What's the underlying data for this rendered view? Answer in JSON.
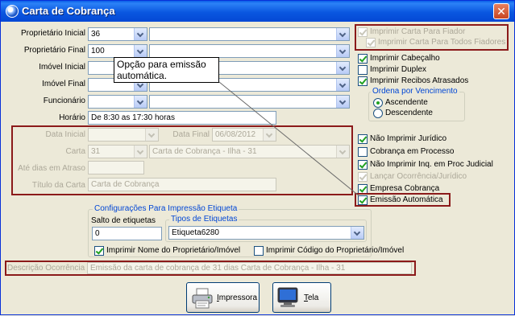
{
  "window": {
    "title": "Carta de Cobrança",
    "close_glyph": "✕"
  },
  "tooltip": {
    "text": "Opção para emissão automática."
  },
  "fields": {
    "proprietario_inicial": {
      "label": "Proprietário Inicial",
      "code": "36",
      "name": ""
    },
    "proprietario_final": {
      "label": "Proprietário Final",
      "code": "100",
      "name": ""
    },
    "imovel_inicial": {
      "label": "Imóvel Inicial",
      "code": "",
      "name": ""
    },
    "imovel_final": {
      "label": "Imóvel Final",
      "code": "",
      "name": ""
    },
    "funcionario": {
      "label": "Funcionário",
      "code": "",
      "name": ""
    },
    "horario": {
      "label": "Horário",
      "value": "De 8:30 as 17:30 horas"
    },
    "data_inicial": {
      "label": "Data Inicial",
      "value": ""
    },
    "data_final": {
      "label": "Data Final",
      "value": "06/08/2012"
    },
    "carta": {
      "label": "Carta",
      "code": "31",
      "name": "Carta de Cobrança - Ilha - 31"
    },
    "ate_dias_atraso": {
      "label": "Até dias em Atraso",
      "value": ""
    },
    "titulo_carta": {
      "label": "Título da Carta",
      "value": "Carta de Cobrança"
    },
    "descricao_ocorrencia": {
      "label": "Descrição Ocorrência",
      "value": "Emissão da carta de cobrança de 31 dias Carta de Cobrança - Ilha - 31"
    }
  },
  "options": {
    "imprimir_carta_fiador": {
      "label": "Imprimir Carta Para Fiador",
      "checked": true,
      "enabled": false
    },
    "imprimir_carta_todos_fiadores": {
      "label": "Imprimir Carta Para Todos Fiadores",
      "checked": true,
      "enabled": false
    },
    "imprimir_cabecalho": {
      "label": "Imprimir Cabeçalho",
      "checked": true
    },
    "imprimir_duplex": {
      "label": "Imprimir Duplex",
      "checked": false
    },
    "imprimir_recibos_atrasados": {
      "label": "Imprimir Recibos Atrasados",
      "checked": true
    },
    "nao_imprimir_juridico": {
      "label": "Não Imprimir Jurídico",
      "checked": true
    },
    "cobranca_em_processo": {
      "label": "Cobrança em Processo",
      "checked": false
    },
    "nao_imprimir_inq_proc_judicial": {
      "label": "Não Imprimir Inq. em Proc Judicial",
      "checked": true
    },
    "lancar_ocorrencia_juridico": {
      "label": "Lançar Ocorrência/Jurídico",
      "checked": true,
      "enabled": false
    },
    "empresa_cobranca": {
      "label": "Empresa Cobrança",
      "checked": true
    },
    "emissao_automatica": {
      "label": "Emissão Automática",
      "checked": true
    }
  },
  "ordering": {
    "title": "Ordena por Vencimento",
    "ascendente": "Ascendente",
    "descendente": "Descendente",
    "selected": "Ascendente"
  },
  "etiqueta": {
    "group_title": "Configurações Para Impressão Etiqueta",
    "salto_label": "Salto de etiquetas",
    "salto_value": "0",
    "tipos_title": "Tipos de Etiquetas",
    "tipo_selected": "Etiqueta6280",
    "imprimir_nome": {
      "label": "Imprimir Nome do Proprietário/Imóvel",
      "checked": true
    },
    "imprimir_codigo": {
      "label": "Imprimir Código do Proprietário/Imóvel",
      "checked": false
    }
  },
  "buttons": {
    "impressora": {
      "label_hot": "I",
      "label_rest": "mpressora",
      "icon": "printer-icon"
    },
    "tela": {
      "label_hot": "T",
      "label_rest": "ela",
      "icon": "monitor-icon"
    }
  },
  "colors": {
    "title_bar": "#0a5ee8",
    "highlight_box": "#8b1a1a",
    "group_title": "#0046d5",
    "check_mark": "#21a121"
  }
}
